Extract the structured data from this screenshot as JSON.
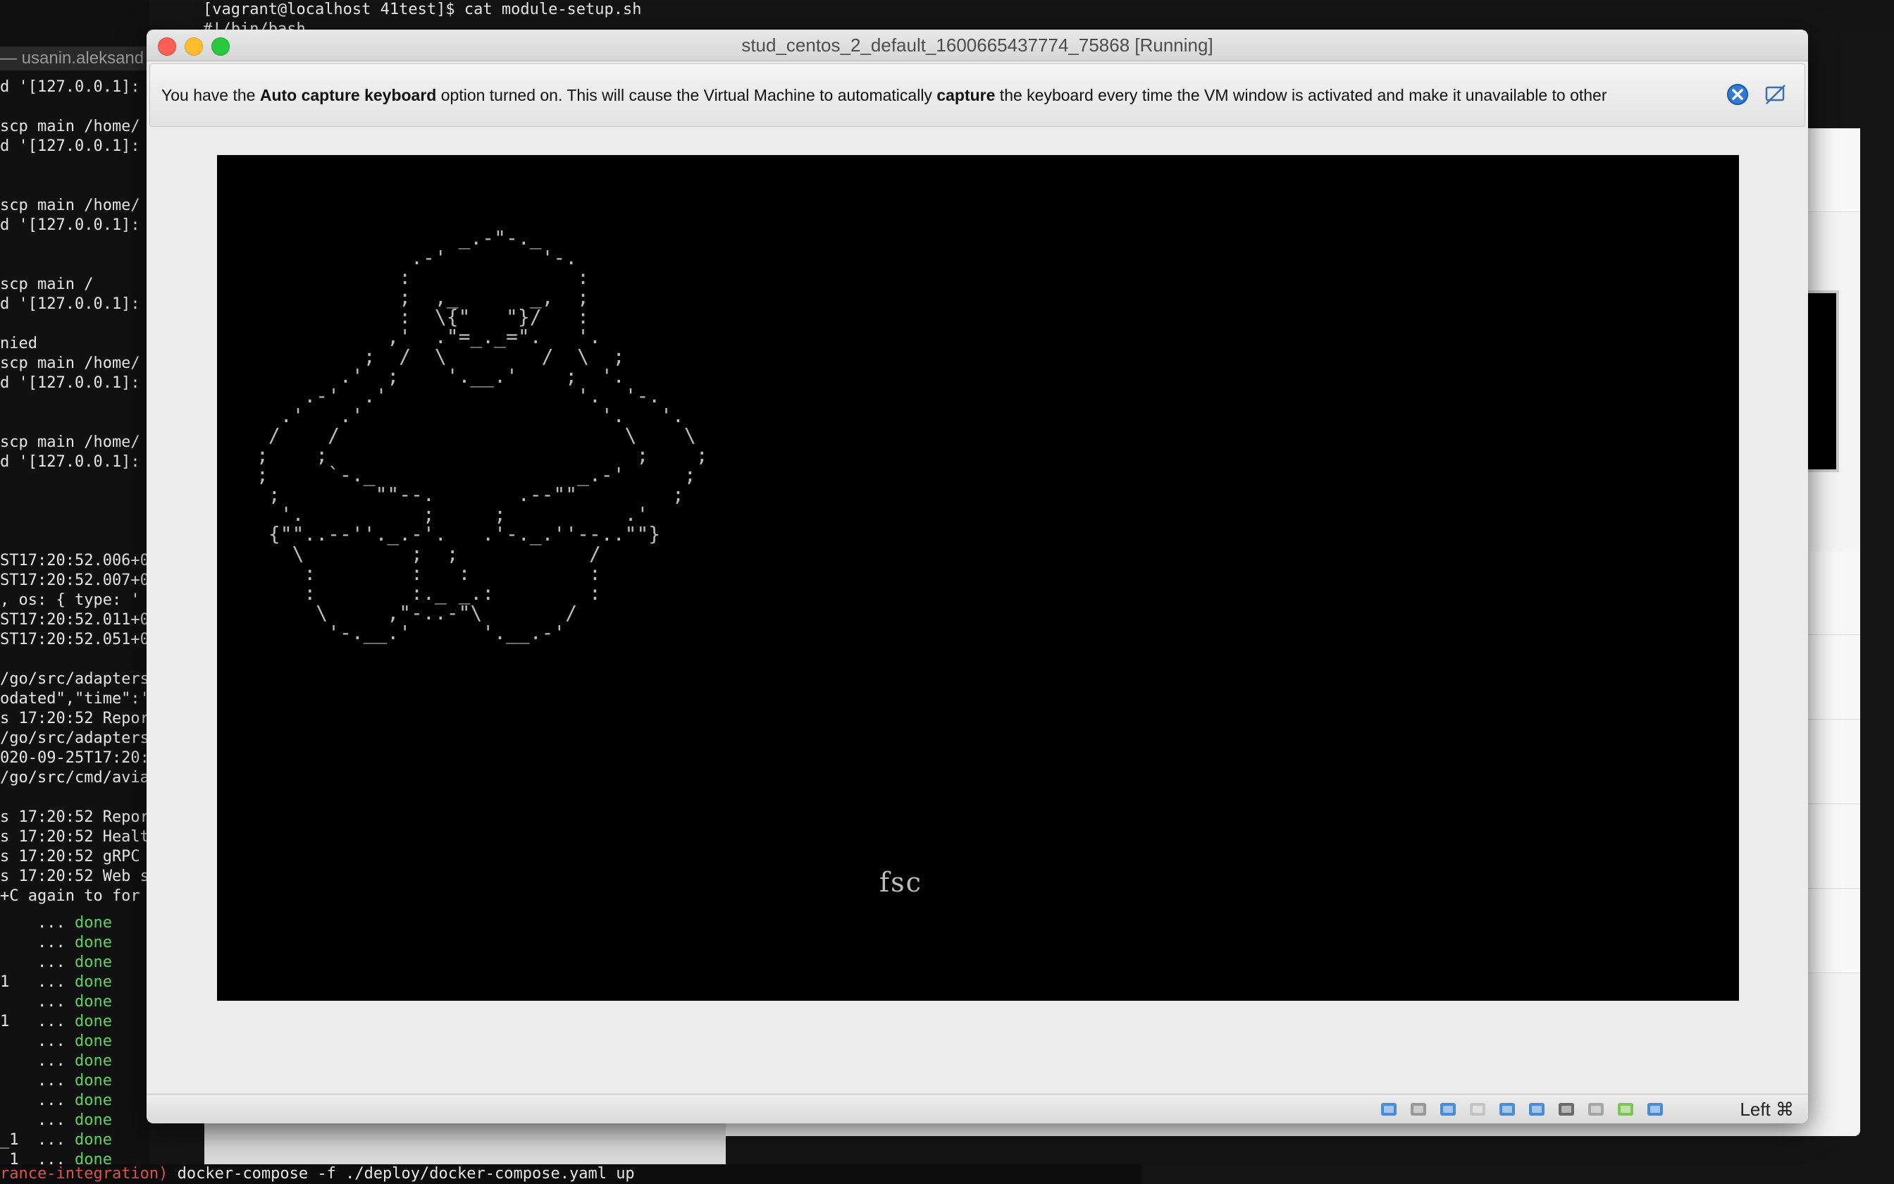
{
  "background_terminal": {
    "top_line": "[vagrant@localhost 41test]$ cat module-setup.sh\n#!/bin/bash",
    "tab_label": "— usanin.aleksand",
    "left_lines": "d '[127.0.0.1]:\n\nscp main /home/\nd '[127.0.0.1]:\n\n\nscp main /home/\nd '[127.0.0.1]:\n\n\nscp main /\nd '[127.0.0.1]:\n\nnied\nscp main /home/\nd '[127.0.0.1]:\n\n\nscp main /home/\nd '[127.0.0.1]:\n\n\n\n\nST17:20:52.006+0\nST17:20:52.007+0\n, os: { type: '\nST17:20:52.011+0\nST17:20:52.051+0\n\n/go/src/adapters\nodated\",\"time\":'\ns 17:20:52 Repor\n/go/src/adapters\n020-09-25T17:20:\n/go/src/cmd/avia\n\ns 17:20:52 Repor\ns 17:20:52 Healt\ns 17:20:52 gRPC\ns 17:20:52 Web s\n+C again to for",
    "done_lines": [
      "    ... ",
      "    ... ",
      "    ... ",
      "1   ... ",
      "    ... ",
      "1   ... ",
      "    ... ",
      "    ... ",
      "    ... ",
      "    ... ",
      "    ... ",
      "_1  ... ",
      "_1  ... "
    ],
    "done_word": "done",
    "bottom_prefix": "rance-integration)",
    "bottom_cmd": " docker-compose -f ./deploy/docker-compose.yaml up"
  },
  "vm_window": {
    "title": "stud_centos_2_default_1600665437774_75868 [Running]",
    "notification": {
      "part1": "You have the ",
      "bold1": "Auto capture keyboard",
      "part2": " option turned on. This will cause the Virtual Machine to automatically ",
      "bold2": "capture",
      "part3": " the keyboard every time the VM window is activated and make it unavailable to other"
    },
    "screen_ascii": "                 _.-\"-._\n             .-'        '-.\n            :              :\n            ;  ,_      _,  ;\n            :  \\{\"   \"}/   :\n           ,'  .\"=_._=\".   '.\n         ;  /  \\        /  \\  ;\n       .'  ;    '.__.'    ;  '.\n    .-'  .'                '.  '-.\n  .'   .'                    '.   '.\n /    /                        \\    \\\n;    ;                          ;    ;\n;     `-._                 _.-'     ;\n ;        \"\"--.       .--\"\"        ;\n  '.          ;     ;          .'\n {\"\"..--''._.-'.   .'-._.''--..\"\"}\n   \\         ;  ;           /\n    :        :   :          :\n    :        :._ _.:        :\n     \\     ,\"-..-\"\\       /\n      '-.__.'      '.__.-'",
    "screen_label": "fsc",
    "host_key": "Left ⌘"
  },
  "status_icons": [
    "hard-disk-icon",
    "optical-drive-icon",
    "network-icon",
    "usb-icon",
    "shared-folder-icon",
    "display-icon",
    "video-capture-icon",
    "cpu-icon",
    "mouse-integration-icon",
    "keyboard-capture-icon"
  ]
}
